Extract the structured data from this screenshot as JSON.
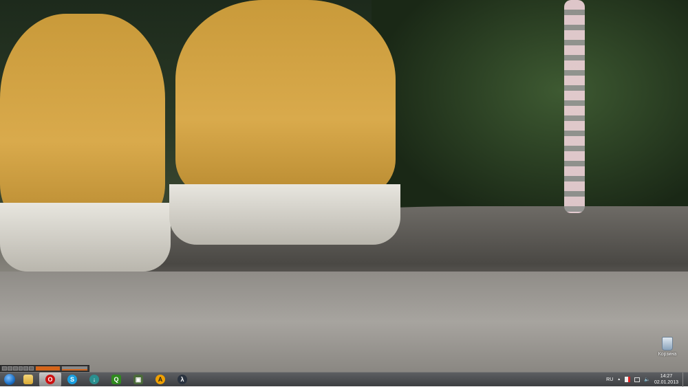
{
  "desktop": {
    "wallpaper": "photo-yellow-sneakers-on-rock",
    "icons": [
      {
        "label": "Корзина",
        "icon": "recycle-bin-icon"
      }
    ]
  },
  "media_player": {
    "accent": "#d4651a"
  },
  "taskbar": {
    "pinned": [
      {
        "name": "windows-explorer",
        "icon": "folder-icon"
      },
      {
        "name": "opera",
        "icon": "opera-icon",
        "active": true,
        "glyph": "O",
        "color": "#cc1010"
      },
      {
        "name": "skype",
        "icon": "skype-icon",
        "glyph": "S",
        "color": "#1a9fe0"
      },
      {
        "name": "download-manager",
        "icon": "download-arrow-icon",
        "glyph": "↓",
        "color": "#2a8f8f"
      },
      {
        "name": "app-green",
        "icon": "green-app-icon",
        "glyph": "Q",
        "color": "#2f8a1e"
      },
      {
        "name": "system-monitor",
        "icon": "monitor-icon",
        "glyph": "▣",
        "color": "#4b6b3a"
      },
      {
        "name": "aimp",
        "icon": "aimp-icon",
        "glyph": "A",
        "color": "#f0a000"
      },
      {
        "name": "half-life",
        "icon": "half-life-icon",
        "glyph": "λ",
        "color": "#2a3340"
      }
    ],
    "tray": {
      "language": "RU",
      "show_hidden": "▲",
      "time": "14:27",
      "date": "02.01.2013"
    }
  }
}
